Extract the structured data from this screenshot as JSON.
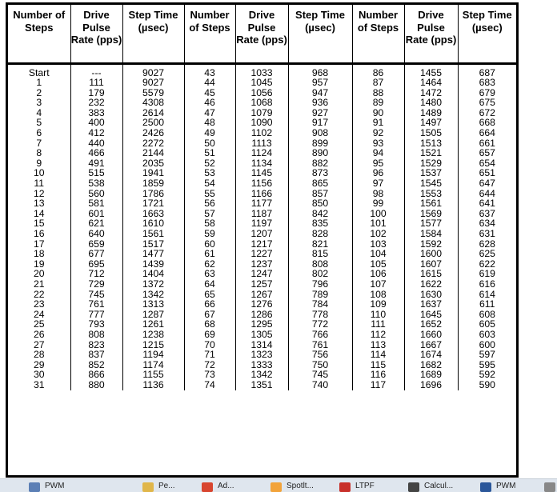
{
  "table": {
    "headers": [
      "Number of Steps",
      "Drive Pulse Rate (pps)",
      "Step Time (µsec)",
      "Number of Steps",
      "Drive Pulse Rate (pps)",
      "Step Time (µsec)",
      "Number of Steps",
      "Drive Pulse Rate (pps)",
      "Step Time (µsec)"
    ],
    "rows": [
      [
        "Start",
        "---",
        "9027",
        "43",
        "1033",
        "968",
        "86",
        "1455",
        "687"
      ],
      [
        "1",
        "111",
        "9027",
        "44",
        "1045",
        "957",
        "87",
        "1464",
        "683"
      ],
      [
        "2",
        "179",
        "5579",
        "45",
        "1056",
        "947",
        "88",
        "1472",
        "679"
      ],
      [
        "3",
        "232",
        "4308",
        "46",
        "1068",
        "936",
        "89",
        "1480",
        "675"
      ],
      [
        "4",
        "383",
        "2614",
        "47",
        "1079",
        "927",
        "90",
        "1489",
        "672"
      ],
      [
        "5",
        "400",
        "2500",
        "48",
        "1090",
        "917",
        "91",
        "1497",
        "668"
      ],
      [
        "6",
        "412",
        "2426",
        "49",
        "1102",
        "908",
        "92",
        "1505",
        "664"
      ],
      [
        "7",
        "440",
        "2272",
        "50",
        "1113",
        "899",
        "93",
        "1513",
        "661"
      ],
      [
        "8",
        "466",
        "2144",
        "51",
        "1124",
        "890",
        "94",
        "1521",
        "657"
      ],
      [
        "9",
        "491",
        "2035",
        "52",
        "1134",
        "882",
        "95",
        "1529",
        "654"
      ],
      [
        "10",
        "515",
        "1941",
        "53",
        "1145",
        "873",
        "96",
        "1537",
        "651"
      ],
      [
        "11",
        "538",
        "1859",
        "54",
        "1156",
        "865",
        "97",
        "1545",
        "647"
      ],
      [
        "12",
        "560",
        "1786",
        "55",
        "1166",
        "857",
        "98",
        "1553",
        "644"
      ],
      [
        "13",
        "581",
        "1721",
        "56",
        "1177",
        "850",
        "99",
        "1561",
        "641"
      ],
      [
        "14",
        "601",
        "1663",
        "57",
        "1187",
        "842",
        "100",
        "1569",
        "637"
      ],
      [
        "15",
        "621",
        "1610",
        "58",
        "1197",
        "835",
        "101",
        "1577",
        "634"
      ],
      [
        "16",
        "640",
        "1561",
        "59",
        "1207",
        "828",
        "102",
        "1584",
        "631"
      ],
      [
        "17",
        "659",
        "1517",
        "60",
        "1217",
        "821",
        "103",
        "1592",
        "628"
      ],
      [
        "18",
        "677",
        "1477",
        "61",
        "1227",
        "815",
        "104",
        "1600",
        "625"
      ],
      [
        "19",
        "695",
        "1439",
        "62",
        "1237",
        "808",
        "105",
        "1607",
        "622"
      ],
      [
        "20",
        "712",
        "1404",
        "63",
        "1247",
        "802",
        "106",
        "1615",
        "619"
      ],
      [
        "21",
        "729",
        "1372",
        "64",
        "1257",
        "796",
        "107",
        "1622",
        "616"
      ],
      [
        "22",
        "745",
        "1342",
        "65",
        "1267",
        "789",
        "108",
        "1630",
        "614"
      ],
      [
        "23",
        "761",
        "1313",
        "66",
        "1276",
        "784",
        "109",
        "1637",
        "611"
      ],
      [
        "24",
        "777",
        "1287",
        "67",
        "1286",
        "778",
        "110",
        "1645",
        "608"
      ],
      [
        "25",
        "793",
        "1261",
        "68",
        "1295",
        "772",
        "111",
        "1652",
        "605"
      ],
      [
        "26",
        "808",
        "1238",
        "69",
        "1305",
        "766",
        "112",
        "1660",
        "603"
      ],
      [
        "27",
        "823",
        "1215",
        "70",
        "1314",
        "761",
        "113",
        "1667",
        "600"
      ],
      [
        "28",
        "837",
        "1194",
        "71",
        "1323",
        "756",
        "114",
        "1674",
        "597"
      ],
      [
        "29",
        "852",
        "1174",
        "72",
        "1333",
        "750",
        "115",
        "1682",
        "595"
      ],
      [
        "30",
        "866",
        "1155",
        "73",
        "1342",
        "745",
        "116",
        "1689",
        "592"
      ],
      [
        "31",
        "880",
        "1136",
        "74",
        "1351",
        "740",
        "117",
        "1696",
        "590"
      ]
    ]
  },
  "taskbar": {
    "items": [
      {
        "label": "PWM",
        "icon": "document-icon",
        "color": "#5b7fb5"
      },
      {
        "label": "Pe...",
        "icon": "folder-icon",
        "color": "#e0b64a"
      },
      {
        "label": "Ad...",
        "icon": "chrome-icon",
        "color": "#d8452f"
      },
      {
        "label": "Spotlt...",
        "icon": "spotlight-icon",
        "color": "#f2a33a"
      },
      {
        "label": "LTPF",
        "icon": "pdf-icon",
        "color": "#c8302a"
      },
      {
        "label": "Calcul...",
        "icon": "calculator-icon",
        "color": "#444444"
      },
      {
        "label": "PWM",
        "icon": "word-icon",
        "color": "#2b579a"
      },
      {
        "label": "",
        "icon": "overflow-icon",
        "color": "#888888"
      }
    ]
  }
}
